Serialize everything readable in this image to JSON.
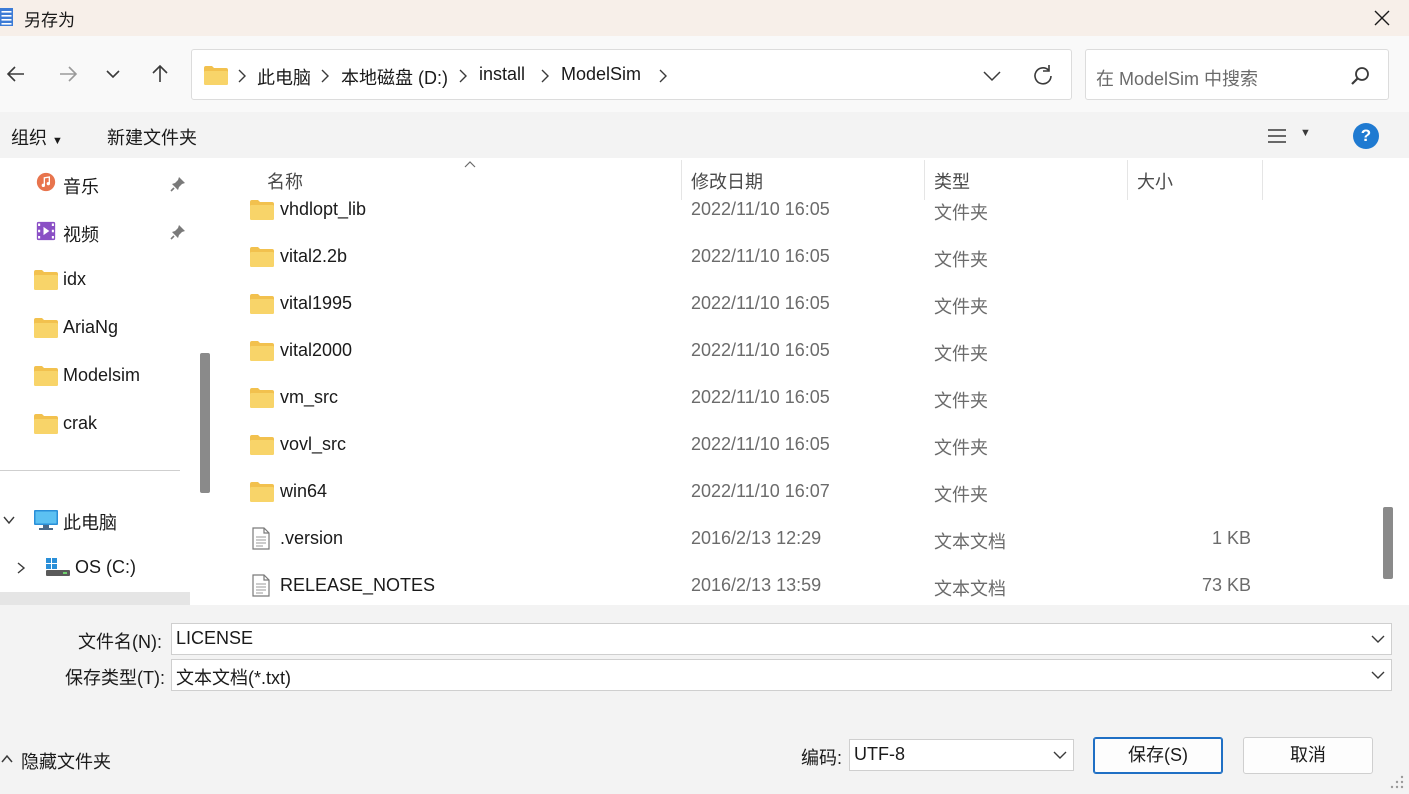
{
  "window": {
    "title": "另存为"
  },
  "nav": {
    "back_icon": "arrow-left-icon",
    "forward_icon": "arrow-right-icon",
    "recent_icon": "chevron-down-icon",
    "up_icon": "arrow-up-icon"
  },
  "address": {
    "crumbs": [
      "此电脑",
      "本地磁盘 (D:)",
      "install",
      "ModelSim"
    ]
  },
  "search": {
    "placeholder": "在 ModelSim 中搜索"
  },
  "commands": {
    "organize": "组织",
    "new_folder": "新建文件夹"
  },
  "sidebar": {
    "items": [
      {
        "label": "音乐",
        "icon": "music-icon",
        "pinned": true
      },
      {
        "label": "视频",
        "icon": "video-icon",
        "pinned": true
      },
      {
        "label": "idx",
        "icon": "folder-icon"
      },
      {
        "label": "AriaNg",
        "icon": "folder-icon"
      },
      {
        "label": "Modelsim",
        "icon": "folder-icon"
      },
      {
        "label": "crak",
        "icon": "folder-icon"
      },
      {
        "label": "此电脑",
        "icon": "computer-icon",
        "expanded": true
      },
      {
        "label": "OS (C:)",
        "icon": "drive-icon",
        "expanded": false
      }
    ]
  },
  "columns": {
    "name": "名称",
    "date": "修改日期",
    "type": "类型",
    "size": "大小"
  },
  "files": [
    {
      "name": "vhdlopt_lib",
      "date": "2022/11/10 16:05",
      "type": "文件夹",
      "size": "",
      "kind": "folder"
    },
    {
      "name": "vital2.2b",
      "date": "2022/11/10 16:05",
      "type": "文件夹",
      "size": "",
      "kind": "folder"
    },
    {
      "name": "vital1995",
      "date": "2022/11/10 16:05",
      "type": "文件夹",
      "size": "",
      "kind": "folder"
    },
    {
      "name": "vital2000",
      "date": "2022/11/10 16:05",
      "type": "文件夹",
      "size": "",
      "kind": "folder"
    },
    {
      "name": "vm_src",
      "date": "2022/11/10 16:05",
      "type": "文件夹",
      "size": "",
      "kind": "folder"
    },
    {
      "name": "vovl_src",
      "date": "2022/11/10 16:05",
      "type": "文件夹",
      "size": "",
      "kind": "folder"
    },
    {
      "name": "win64",
      "date": "2022/11/10 16:07",
      "type": "文件夹",
      "size": "",
      "kind": "folder"
    },
    {
      "name": ".version",
      "date": "2016/2/13 12:29",
      "type": "文本文档",
      "size": "1 KB",
      "kind": "text"
    },
    {
      "name": "RELEASE_NOTES",
      "date": "2016/2/13 13:59",
      "type": "文本文档",
      "size": "73 KB",
      "kind": "text"
    }
  ],
  "form": {
    "filename_label": "文件名(N):",
    "filename_value": "LICENSE",
    "filetype_label": "保存类型(T):",
    "filetype_value": "文本文档(*.txt)"
  },
  "footer": {
    "hide_folders": "隐藏文件夹",
    "encoding_label": "编码:",
    "encoding_value": "UTF-8",
    "save_button": "保存(S)",
    "cancel_button": "取消"
  },
  "colors": {
    "accent": "#1f7ad1",
    "folder": "#f2c14e",
    "titlebar": "#f7efe9"
  }
}
